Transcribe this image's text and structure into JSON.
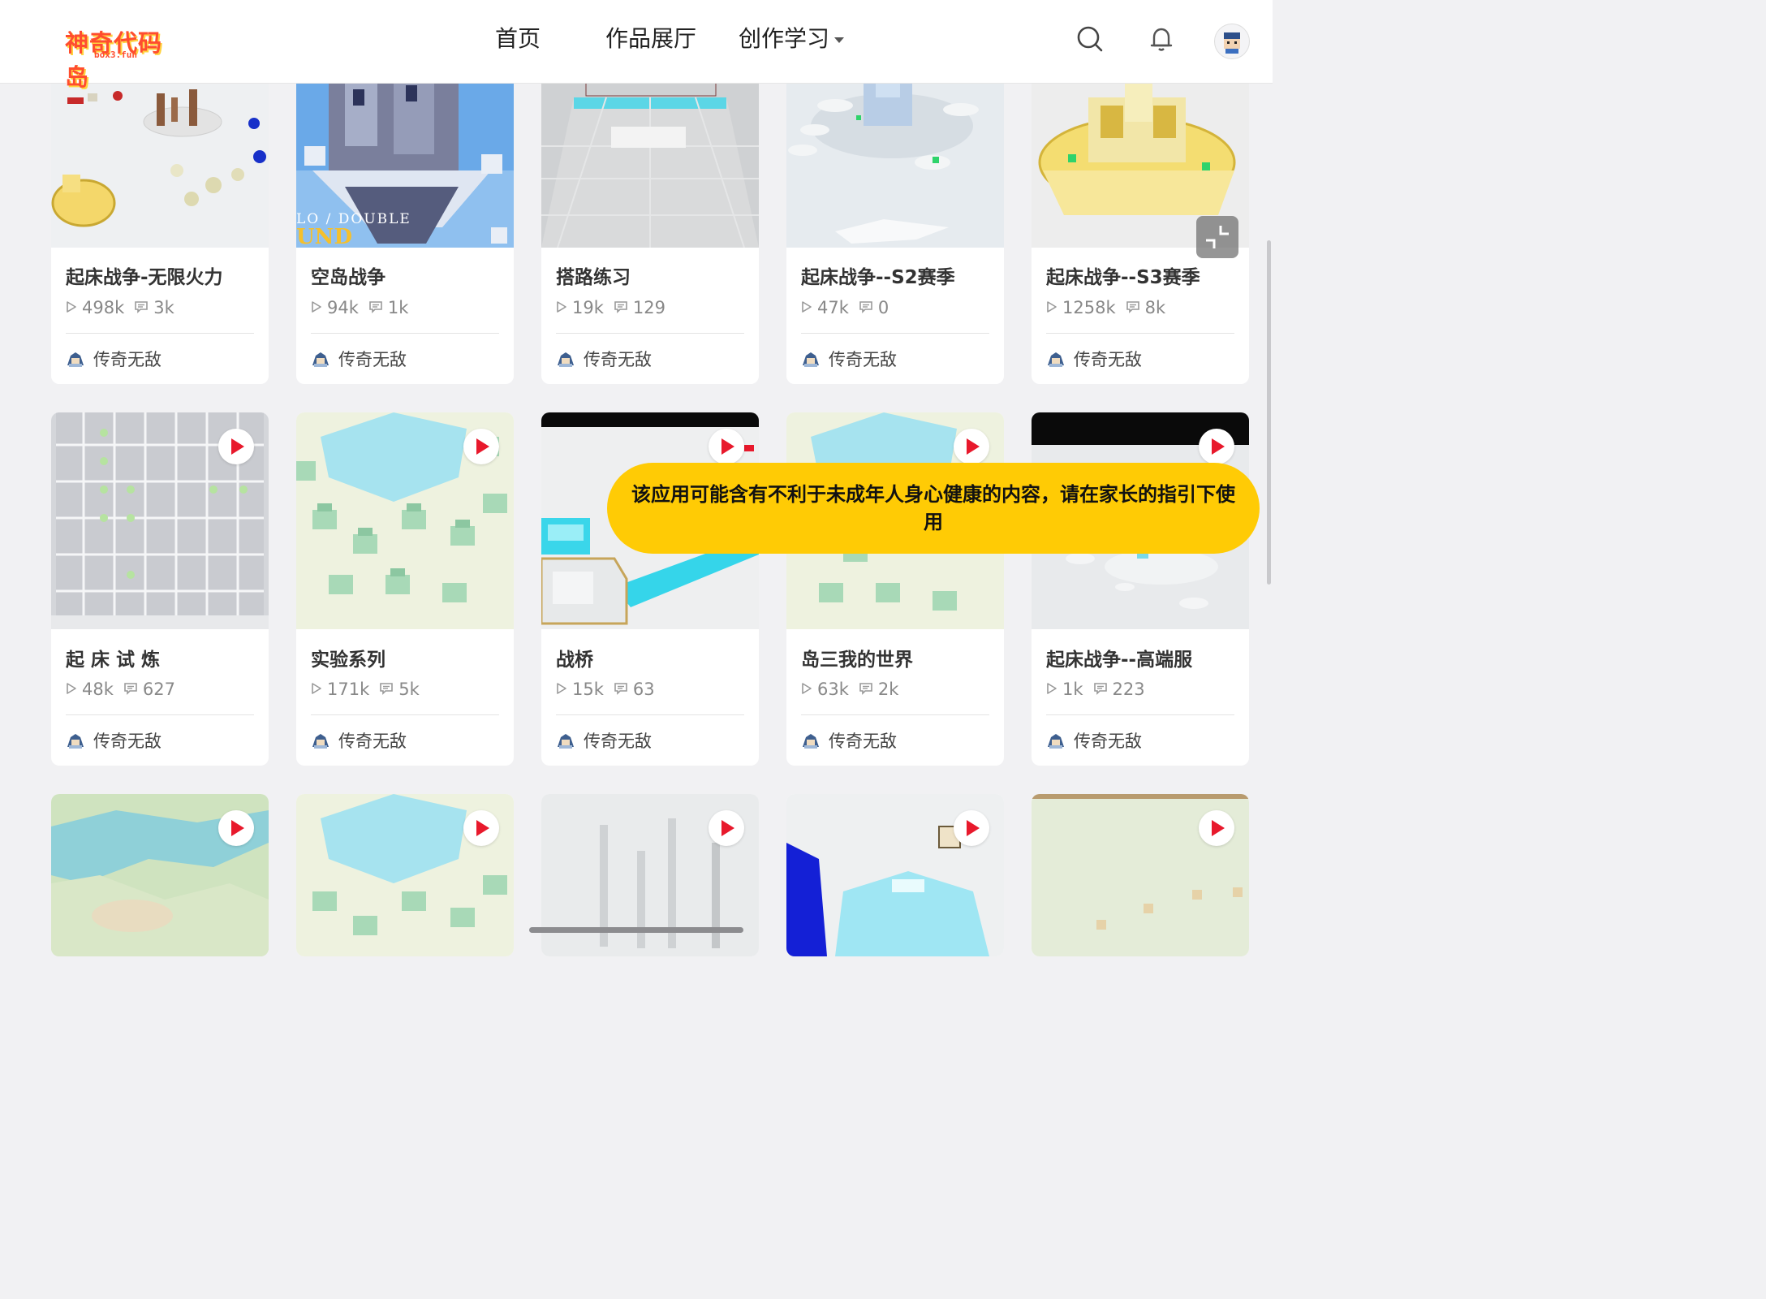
{
  "header": {
    "logo_text": "神奇代码岛",
    "logo_sub": "box3.fun",
    "nav": [
      "首页",
      "作品展厅",
      "创作学习"
    ]
  },
  "icons": {
    "search": "search-icon",
    "bell": "bell-icon",
    "play": "play-icon",
    "view": "play-count-icon",
    "comment": "comment-icon",
    "fullscreen": "exit-fullscreen-icon"
  },
  "colors": {
    "accent_red": "#e8192c",
    "toast_bg": "#ffcb05",
    "logo": "#ff4d2e"
  },
  "cards_row1": [
    {
      "title": "起床战争-无限火力",
      "views": "498k",
      "comments": "3k",
      "author": "传奇无敌"
    },
    {
      "title": "空岛战争",
      "views": "94k",
      "comments": "1k",
      "author": "传奇无敌",
      "thumb_text": [
        "LO / DOUBLE",
        "UND"
      ]
    },
    {
      "title": "搭路练习",
      "views": "19k",
      "comments": "129",
      "author": "传奇无敌"
    },
    {
      "title": "起床战争--S2赛季",
      "views": "47k",
      "comments": "0",
      "author": "传奇无敌"
    },
    {
      "title": "起床战争--S3赛季",
      "views": "1258k",
      "comments": "8k",
      "author": "传奇无敌"
    }
  ],
  "cards_row2": [
    {
      "title": "起 床 试 炼",
      "views": "48k",
      "comments": "627",
      "author": "传奇无敌"
    },
    {
      "title": "实验系列",
      "views": "171k",
      "comments": "5k",
      "author": "传奇无敌"
    },
    {
      "title": "战桥",
      "views": "15k",
      "comments": "63",
      "author": "传奇无敌"
    },
    {
      "title": "岛三我的世界",
      "views": "63k",
      "comments": "2k",
      "author": "传奇无敌"
    },
    {
      "title": "起床战争--高端服",
      "views": "1k",
      "comments": "223",
      "author": "传奇无敌"
    }
  ],
  "toast": "该应用可能含有不利于未成年人身心健康的内容，请在家长的指引下使用"
}
